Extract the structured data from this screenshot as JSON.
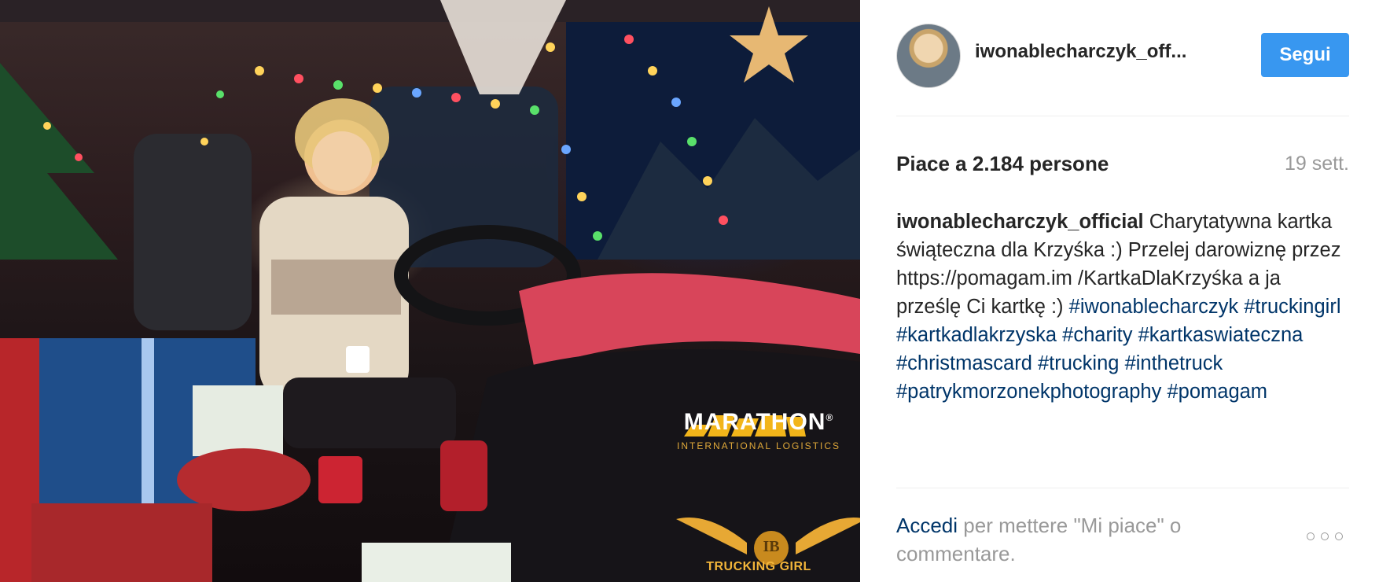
{
  "photo": {
    "brand_name": "MARATHON",
    "brand_mark": "®",
    "brand_subtitle": "INTERNATIONAL LOGISTICS",
    "badge_initials": "IB",
    "badge_label": "TRUCKING GIRL"
  },
  "header": {
    "username": "iwonablecharczyk_off...",
    "follow_label": "Segui"
  },
  "stats": {
    "likes_text": "Piace a 2.184 persone",
    "date": "19 sett."
  },
  "caption": {
    "author": "iwonablecharczyk_official",
    "text": " Charytatywna kartka świąteczna dla Krzyśka :) Przelej darowiznę przez https://pomagam.im /KartkaDlaKrzyśka a ja prześlę Ci kartkę :) ",
    "hashtags": [
      "#iwonablecharczyk",
      "#truckingirl",
      "#kartkadlakrzyska",
      "#charity",
      "#kartkaswiateczna",
      "#christmascard",
      "#trucking",
      "#inthetruck",
      "#patrykmorzonekphotography",
      "#pomagam"
    ]
  },
  "footer": {
    "login_link": "Accedi",
    "login_rest": " per mettere \"Mi piace\" o commentare."
  },
  "colors": {
    "follow_button": "#3897f0",
    "link": "#003569",
    "muted": "#999999",
    "text": "#262626"
  }
}
